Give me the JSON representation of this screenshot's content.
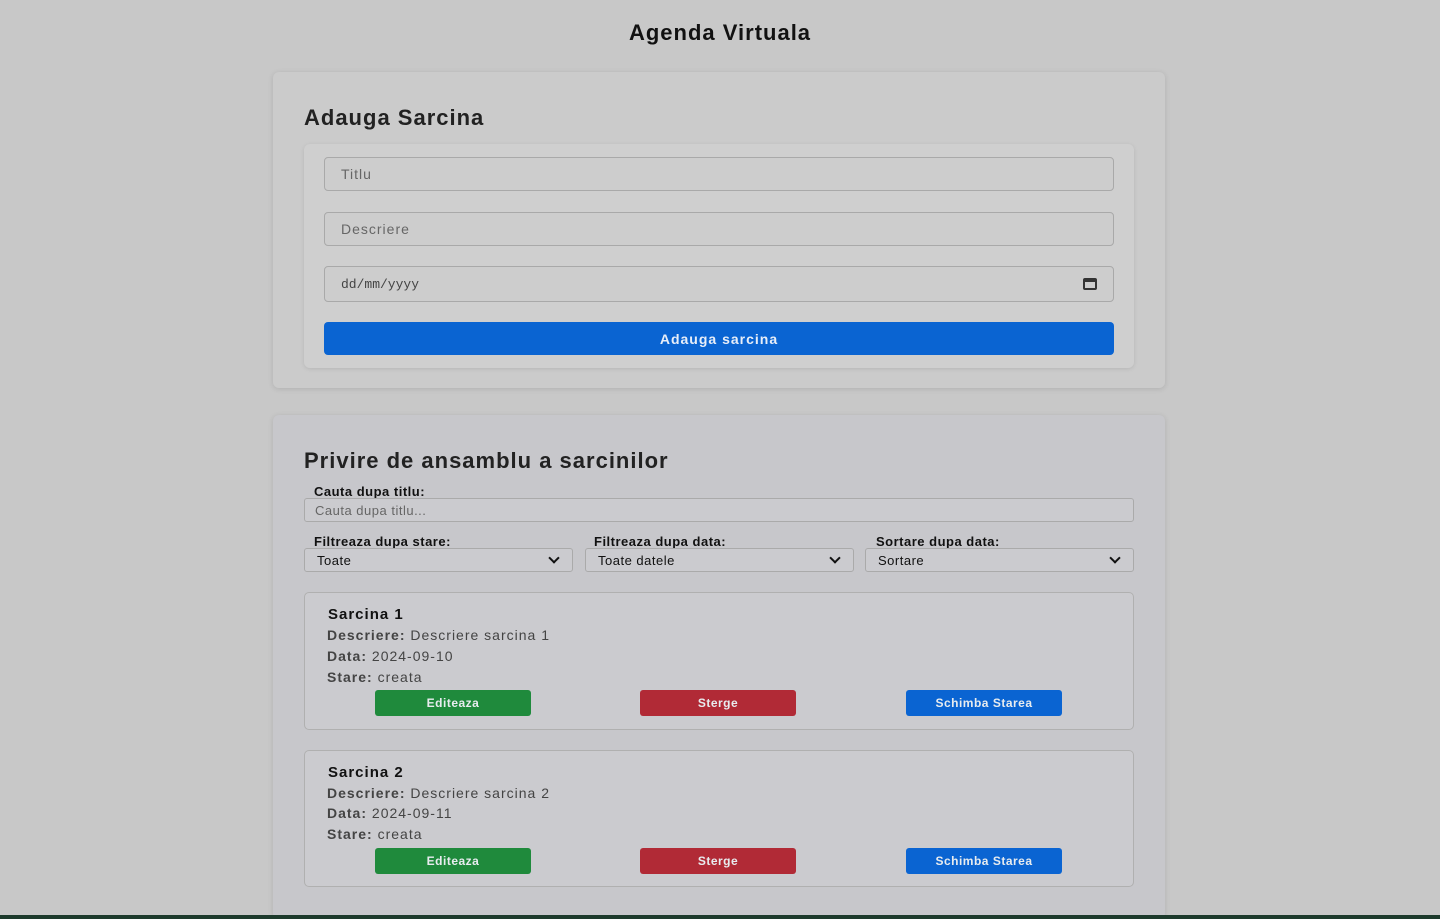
{
  "app": {
    "title": "Agenda Virtuala"
  },
  "add_form": {
    "heading": "Adauga Sarcina",
    "title_placeholder": "Titlu",
    "description_placeholder": "Descriere",
    "date_placeholder": "dd/mm/yyyy",
    "submit_label": "Adauga sarcina"
  },
  "overview": {
    "heading": "Privire de ansamblu a sarcinilor",
    "search_label": "Cauta dupa titlu:",
    "search_placeholder": "Cauta dupa titlu...",
    "filters": [
      {
        "label": "Filtreaza dupa stare:",
        "value": "Toate"
      },
      {
        "label": "Filtreaza dupa data:",
        "value": "Toate datele"
      },
      {
        "label": "Sortare dupa data:",
        "value": "Sortare"
      }
    ],
    "field_labels": {
      "description": "Descriere:",
      "date": "Data:",
      "state": "Stare:"
    },
    "tasks": [
      {
        "title": "Sarcina 1",
        "description": "Descriere sarcina 1",
        "date": "2024-09-10",
        "state": "creata",
        "edit_label": "Editeaza",
        "delete_label": "Sterge",
        "change_state_label": "Schimba Starea"
      },
      {
        "title": "Sarcina 2",
        "description": "Descriere sarcina 2",
        "date": "2024-09-11",
        "state": "creata",
        "edit_label": "Editeaza",
        "delete_label": "Sterge",
        "change_state_label": "Schimba Starea"
      }
    ]
  },
  "colors": {
    "primary": "#0a64d2",
    "success": "#1f8a3c",
    "danger": "#b12a36",
    "background": "#c8c8c8"
  }
}
